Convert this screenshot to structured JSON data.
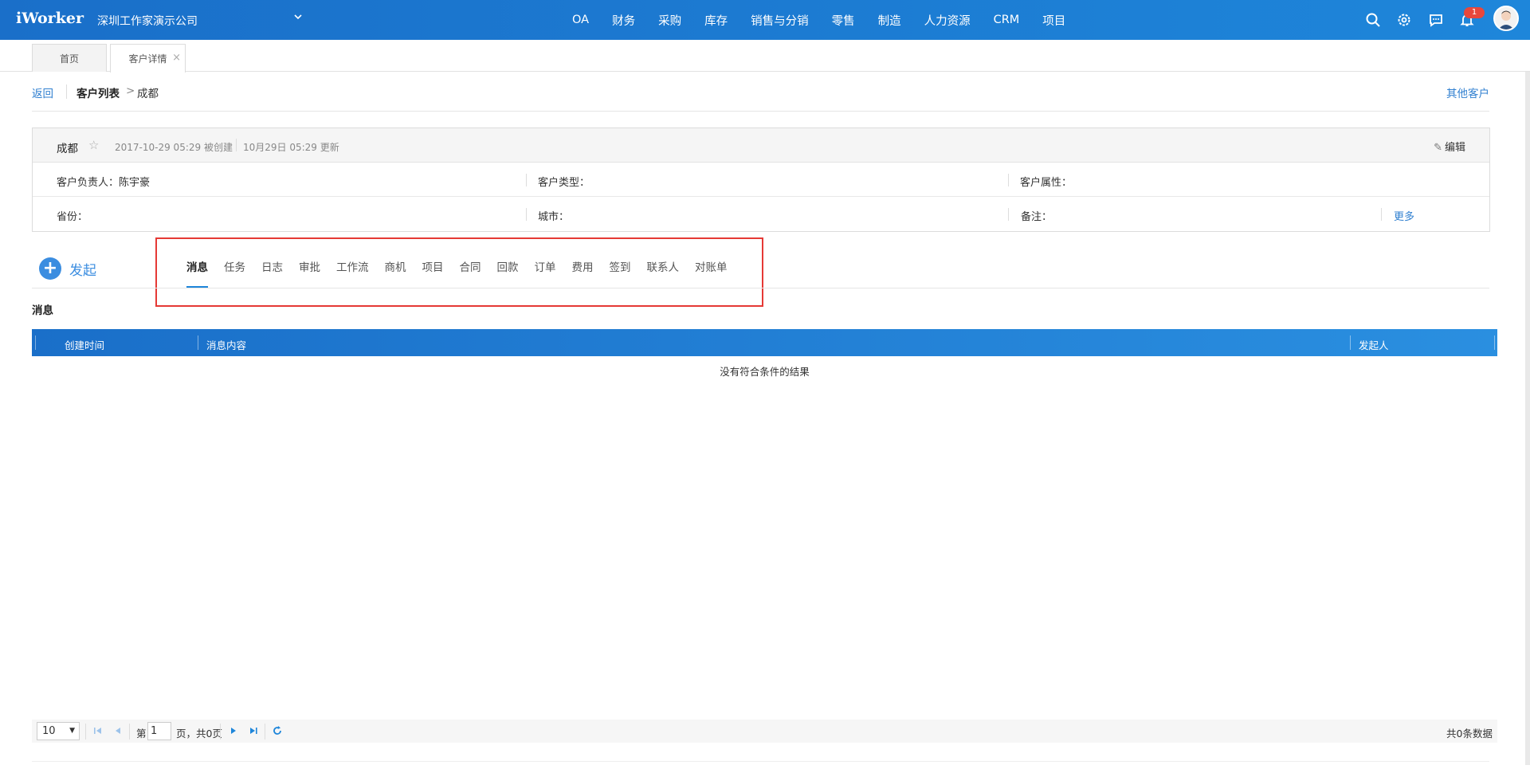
{
  "app": {
    "logo": "iWorker",
    "company": "深圳工作家演示公司"
  },
  "nav": {
    "items": [
      "OA",
      "财务",
      "采购",
      "库存",
      "销售与分销",
      "零售",
      "制造",
      "人力资源",
      "CRM",
      "项目"
    ]
  },
  "header": {
    "notification_count": "1"
  },
  "tabs": {
    "home": "首页",
    "active": "客户详情",
    "close": "×"
  },
  "breadcrumb": {
    "back": "返回",
    "parent": "客户列表",
    "sep": ">",
    "current": "成都",
    "other": "其他客户"
  },
  "customer": {
    "name": "成都",
    "created": "2017-10-29 05:29 被创建",
    "updated": "10月29日 05:29 更新",
    "edit_label": "编辑",
    "owner": "客户负责人：陈宇豪",
    "type": "客户类型：",
    "attribute": "客户属性：",
    "province": "省份：",
    "city": "城市：",
    "remark": "备注：",
    "more": "更多"
  },
  "actions": {
    "launch": "发起"
  },
  "subtabs": [
    "消息",
    "任务",
    "日志",
    "审批",
    "工作流",
    "商机",
    "项目",
    "合同",
    "回款",
    "订单",
    "费用",
    "签到",
    "联系人",
    "对账单"
  ],
  "section": {
    "title": "消息"
  },
  "table": {
    "columns": [
      "创建时间",
      "消息内容",
      "发起人"
    ],
    "empty_text": "没有符合条件的结果"
  },
  "pager": {
    "page_size": "10",
    "page_prefix": "第",
    "page": "1",
    "page_suffix": "页，共0页",
    "total": "共0条数据"
  },
  "colors": {
    "brand": "#1e86da",
    "highlight_box": "#e53935",
    "badge": "#e8473c"
  }
}
